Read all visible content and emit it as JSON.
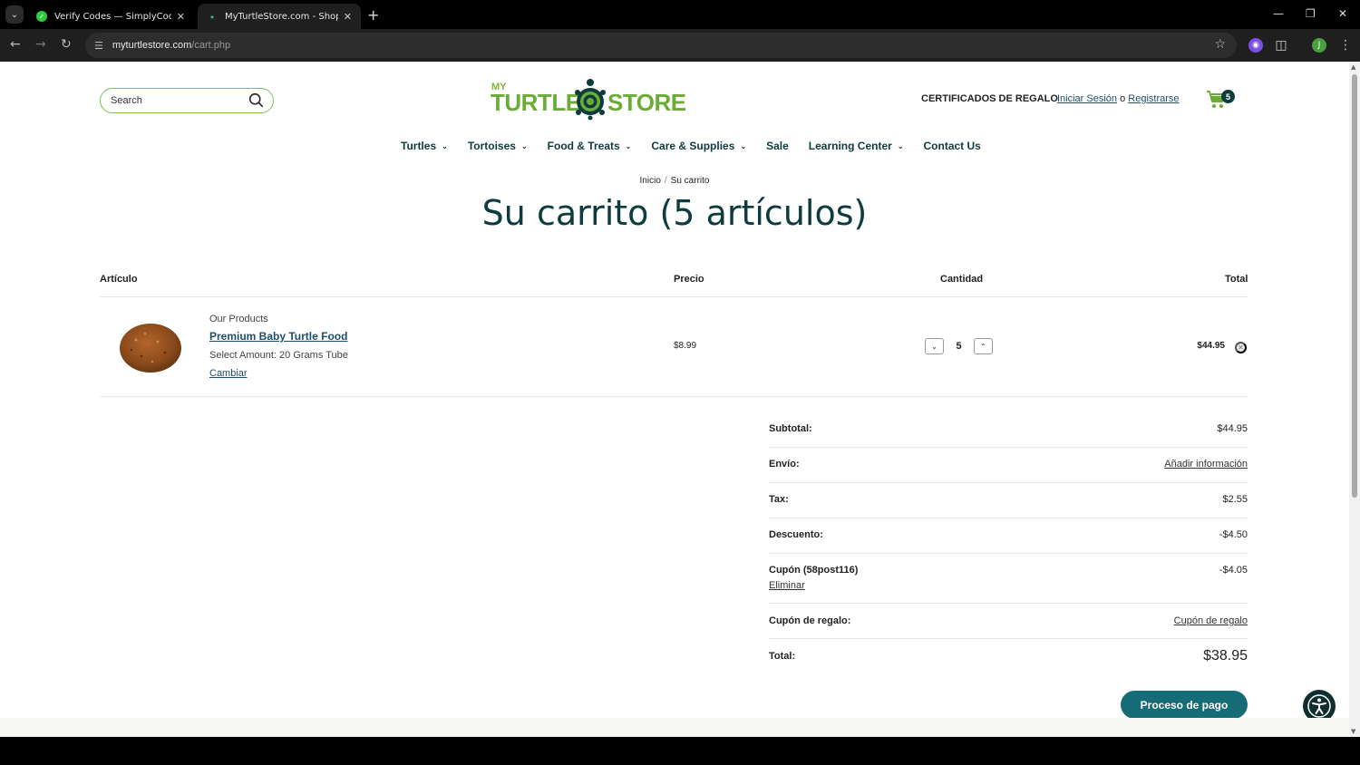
{
  "browser": {
    "tabs": [
      {
        "title": "Verify Codes — SimplyCodes",
        "active": false
      },
      {
        "title": "MyTurtleStore.com - Shopping",
        "active": true
      }
    ],
    "url_domain": "myturtlestore.com",
    "url_path": "/cart.php",
    "profile_initial": "J"
  },
  "header": {
    "search_placeholder": "Search",
    "logo_my": "MY",
    "logo_turtle": "TURTLE",
    "logo_store": "STORE",
    "gift_certificates": "CERTIFICADOS DE REGALO",
    "login": "Iniciar Sesión",
    "or": "o",
    "register": "Registrarse",
    "cart_count": "5"
  },
  "nav": [
    {
      "label": "Turtles",
      "dropdown": true
    },
    {
      "label": "Tortoises",
      "dropdown": true
    },
    {
      "label": "Food & Treats",
      "dropdown": true
    },
    {
      "label": "Care & Supplies",
      "dropdown": true
    },
    {
      "label": "Sale",
      "dropdown": false
    },
    {
      "label": "Learning Center",
      "dropdown": true
    },
    {
      "label": "Contact Us",
      "dropdown": false
    }
  ],
  "breadcrumb": {
    "home": "Inicio",
    "sep": "/",
    "current": "Su carrito"
  },
  "page_title": "Su carrito (5 artículos)",
  "table": {
    "headers": {
      "item": "Artículo",
      "price": "Precio",
      "qty": "Cantidad",
      "total": "Total"
    },
    "rows": [
      {
        "brand": "Our Products",
        "name": "Premium Baby Turtle Food",
        "option": "Select Amount: 20 Grams Tube",
        "change": "Cambiar",
        "price": "$8.99",
        "qty": "5",
        "total": "$44.95"
      }
    ]
  },
  "summary": {
    "subtotal_label": "Subtotal:",
    "subtotal": "$44.95",
    "shipping_label": "Envío:",
    "shipping_link": "Añadir información",
    "tax_label": "Tax:",
    "tax": "$2.55",
    "discount_label": "Descuento:",
    "discount": "-$4.50",
    "coupon_label": "Cupón (58post116)",
    "coupon": "-$4.05",
    "coupon_remove": "Eliminar",
    "gift_label": "Cupón de regalo:",
    "gift_link": "Cupón de regalo",
    "total_label": "Total:",
    "total": "$38.95",
    "checkout": "Proceso de pago"
  },
  "colors": {
    "brand_green": "#6aac36",
    "dark_teal": "#0e3b3c",
    "checkout_teal": "#156c77"
  }
}
